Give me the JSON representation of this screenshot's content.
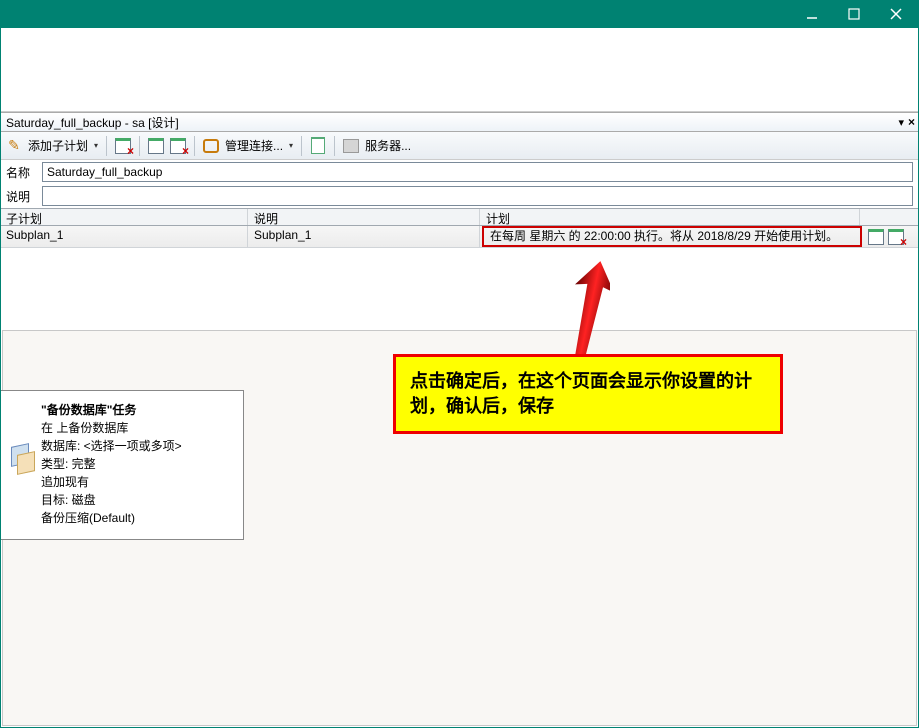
{
  "window": {
    "tab_title": "Saturday_full_backup - sa [设计]"
  },
  "toolbar": {
    "add_subplan": "添加子计划",
    "manage_conn": "管理连接...",
    "servers": "服务器..."
  },
  "form": {
    "name_label": "名称",
    "name_value": "Saturday_full_backup",
    "desc_label": "说明",
    "desc_value": ""
  },
  "grid": {
    "headers": {
      "subplan": "子计划",
      "desc": "说明",
      "plan": "计划"
    },
    "rows": [
      {
        "subplan": "Subplan_1",
        "desc": "Subplan_1",
        "plan": "在每周 星期六 的 22:00:00 执行。将从 2018/8/29 开始使用计划。"
      }
    ]
  },
  "task_box": {
    "title": "\"备份数据库\"任务",
    "lines": [
      "在 上备份数据库",
      "数据库: <选择一项或多项>",
      "类型: 完整",
      "追加现有",
      "目标: 磁盘",
      "备份压缩(Default)"
    ]
  },
  "callout": {
    "text": "点击确定后，在这个页面会显示你设置的计划，确认后，保存"
  }
}
